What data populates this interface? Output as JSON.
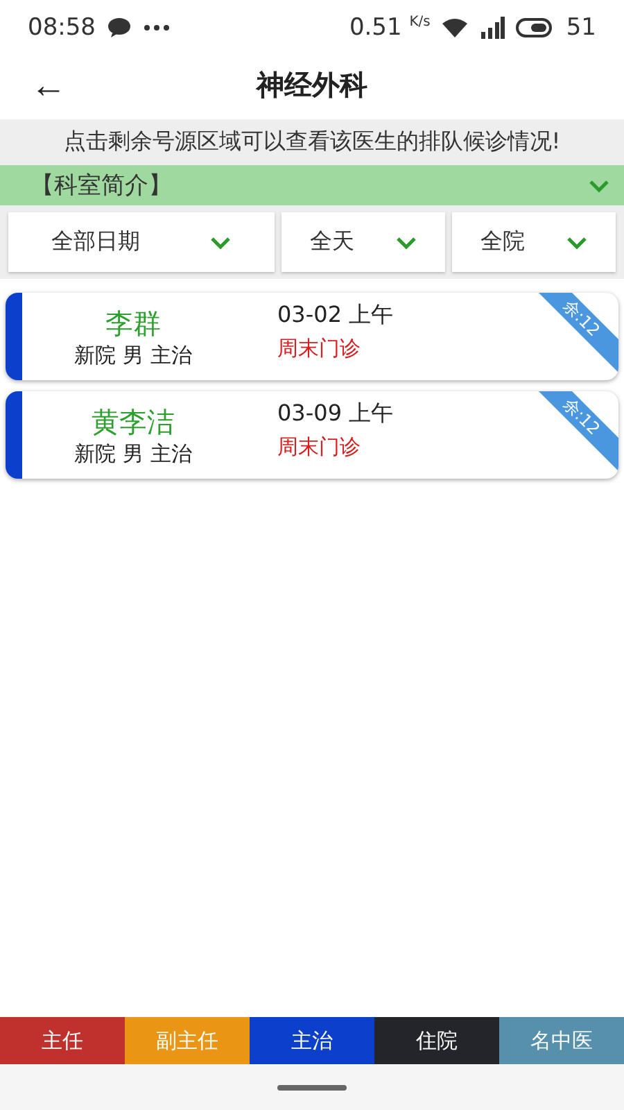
{
  "status_bar": {
    "time": "08:58",
    "speed": "0.51",
    "speed_unit": "K/s",
    "battery": "51"
  },
  "header": {
    "title": "神经外科",
    "back": "←"
  },
  "notice": "点击剩余号源区域可以查看该医生的排队候诊情况!",
  "intro": {
    "label": "【科室简介】",
    "expanded": false
  },
  "filters": [
    {
      "label": "全部日期"
    },
    {
      "label": "全天"
    },
    {
      "label": "全院"
    }
  ],
  "doctors": [
    {
      "name": "李群",
      "info": "新院 男 主治",
      "date": "03-02 上午",
      "clinic": "周末门诊",
      "remaining": "余:12",
      "color": "#0b3fcc"
    },
    {
      "name": "黄李洁",
      "info": "新院 男 主治",
      "date": "03-09 上午",
      "clinic": "周末门诊",
      "remaining": "余:12",
      "color": "#0b3fcc"
    }
  ],
  "legend": [
    {
      "label": "主任",
      "color": "#c0312d"
    },
    {
      "label": "副主任",
      "color": "#ea9514"
    },
    {
      "label": "主治",
      "color": "#0b3fcc"
    },
    {
      "label": "住院",
      "color": "#24252b"
    },
    {
      "label": "名中医",
      "color": "#5790ac"
    }
  ]
}
